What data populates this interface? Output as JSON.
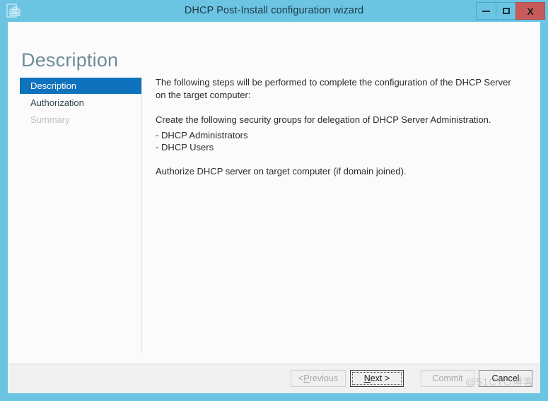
{
  "window": {
    "title": "DHCP Post-Install configuration wizard",
    "app_icon": "dhcp-server-icon",
    "border_color": "#6cc4e3",
    "controls": [
      {
        "name": "minimize",
        "glyph": "minimize-icon"
      },
      {
        "name": "maximize",
        "glyph": "maximize-icon"
      },
      {
        "name": "close",
        "glyph": "close-icon",
        "label": "X",
        "color": "#c75b5b"
      }
    ]
  },
  "page": {
    "heading": "Description",
    "heading_color": "#6e8c98"
  },
  "sidebar": {
    "accent_color": "#0f72bc",
    "items": [
      {
        "label": "Description",
        "state": "selected"
      },
      {
        "label": "Authorization",
        "state": "enabled"
      },
      {
        "label": "Summary",
        "state": "disabled"
      }
    ]
  },
  "content": {
    "intro": "The following steps will be performed to complete the configuration of the DHCP Server on the target computer:",
    "groups_heading": "Create the following security groups for delegation of DHCP Server Administration.",
    "groups": [
      "- DHCP Administrators",
      "- DHCP Users"
    ],
    "authorize_note": "Authorize DHCP server on target computer (if domain joined)."
  },
  "footer": {
    "buttons": [
      {
        "name": "previous",
        "prefix": "< ",
        "accel": "P",
        "suffix": "revious",
        "state": "disabled"
      },
      {
        "name": "next",
        "prefix": "",
        "accel": "N",
        "suffix": "ext >",
        "state": "focused"
      },
      {
        "name": "commit",
        "prefix": "",
        "accel": "",
        "suffix": "Commit",
        "state": "disabled"
      },
      {
        "name": "cancel",
        "prefix": "",
        "accel": "",
        "suffix": "Cancel",
        "state": "enabled"
      }
    ]
  },
  "watermark": {
    "text": "@51CTO博客"
  }
}
